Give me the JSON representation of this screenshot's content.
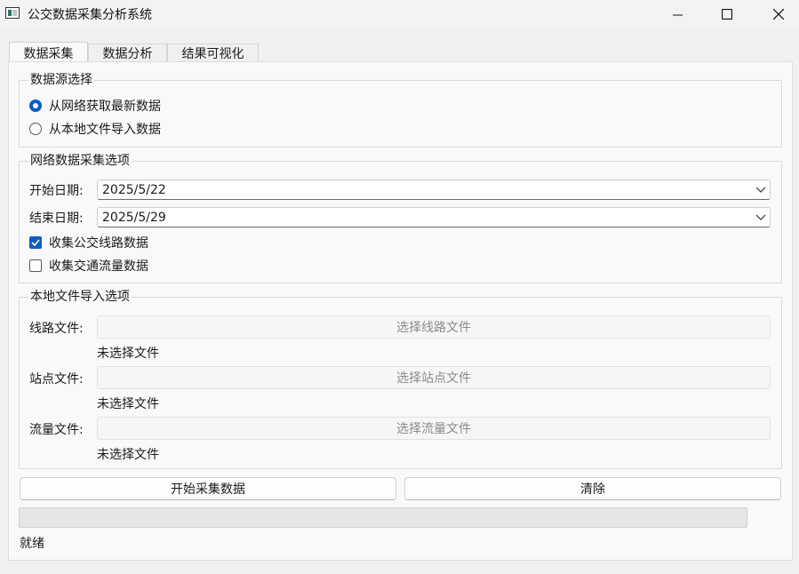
{
  "window": {
    "title": "公交数据采集分析系统"
  },
  "tabs": [
    {
      "label": "数据采集",
      "active": true
    },
    {
      "label": "数据分析",
      "active": false
    },
    {
      "label": "结果可视化",
      "active": false
    }
  ],
  "source": {
    "title": "数据源选择",
    "options": [
      {
        "label": "从网络获取最新数据",
        "checked": true
      },
      {
        "label": "从本地文件导入数据",
        "checked": false
      }
    ]
  },
  "network": {
    "title": "网络数据采集选项",
    "start_label": "开始日期:",
    "start_value": "2025/5/22",
    "end_label": "结束日期:",
    "end_value": "2025/5/29",
    "collect_routes": {
      "label": "收集公交线路数据",
      "checked": true
    },
    "collect_traffic": {
      "label": "收集交通流量数据",
      "checked": false
    }
  },
  "local": {
    "title": "本地文件导入选项",
    "files": [
      {
        "label": "线路文件:",
        "button": "选择线路文件",
        "status": "未选择文件"
      },
      {
        "label": "站点文件:",
        "button": "选择站点文件",
        "status": "未选择文件"
      },
      {
        "label": "流量文件:",
        "button": "选择流量文件",
        "status": "未选择文件"
      }
    ]
  },
  "actions": {
    "start": "开始采集数据",
    "clear": "清除"
  },
  "progress": {
    "value": 0
  },
  "status": "就绪",
  "colors": {
    "accent": "#0f5cc0"
  }
}
